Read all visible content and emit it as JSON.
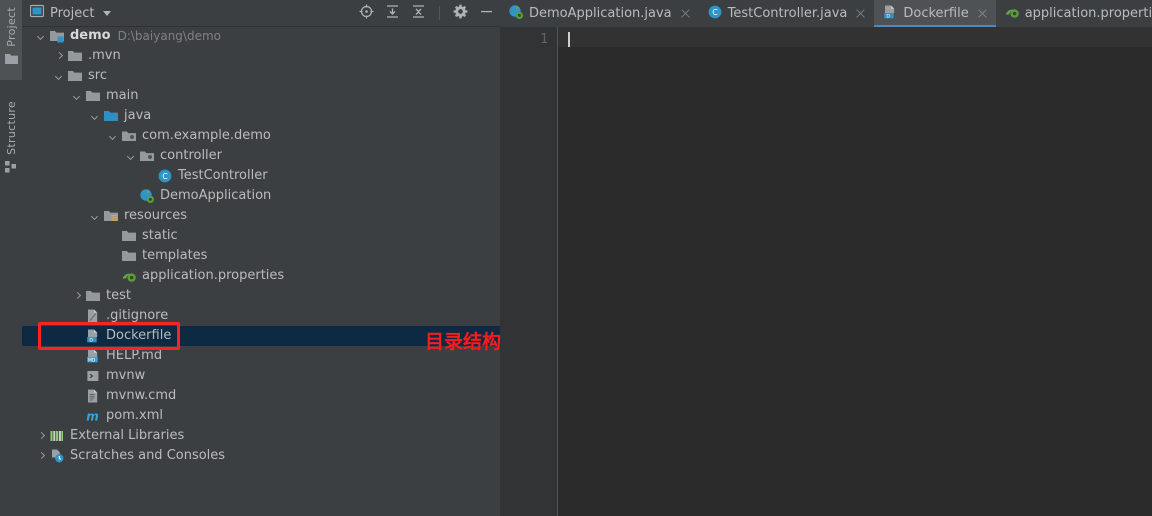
{
  "toolwindows": [
    {
      "label": "Project",
      "icon": "project-window-icon",
      "active": true
    },
    {
      "label": "Structure",
      "icon": "structure-window-icon",
      "active": false
    }
  ],
  "project_panel": {
    "title": "Project",
    "title_icon": "project-view-icon",
    "dropdown_icon": "chevron-down-icon",
    "tools": [
      {
        "name": "locate-in-tree-icon",
        "label": "Select Opened File"
      },
      {
        "name": "expand-all-icon",
        "label": "Expand All"
      },
      {
        "name": "collapse-all-icon",
        "label": "Collapse All"
      },
      {
        "name": "gear-icon",
        "label": "Show Options Menu"
      },
      {
        "name": "minimize-icon",
        "label": "Hide"
      }
    ],
    "tree": [
      {
        "label": "demo",
        "path": "D:\\baiyang\\demo",
        "icon": "module-folder-icon",
        "indent": 0,
        "arrow": "down",
        "bold": true,
        "selected": false
      },
      {
        "label": ".mvn",
        "path": "",
        "icon": "folder-icon",
        "indent": 1,
        "arrow": "right",
        "bold": false,
        "selected": false
      },
      {
        "label": "src",
        "path": "",
        "icon": "folder-icon",
        "indent": 1,
        "arrow": "down",
        "bold": false,
        "selected": false
      },
      {
        "label": "main",
        "path": "",
        "icon": "folder-icon",
        "indent": 2,
        "arrow": "down",
        "bold": false,
        "selected": false
      },
      {
        "label": "java",
        "path": "",
        "icon": "source-root-folder-icon",
        "indent": 3,
        "arrow": "down",
        "bold": false,
        "selected": false
      },
      {
        "label": "com.example.demo",
        "path": "",
        "icon": "package-icon",
        "indent": 4,
        "arrow": "down",
        "bold": false,
        "selected": false
      },
      {
        "label": "controller",
        "path": "",
        "icon": "package-icon",
        "indent": 5,
        "arrow": "down",
        "bold": false,
        "selected": false
      },
      {
        "label": "TestController",
        "path": "",
        "icon": "java-class-icon",
        "indent": 6,
        "arrow": "none",
        "bold": false,
        "selected": false
      },
      {
        "label": "DemoApplication",
        "path": "",
        "icon": "spring-boot-class-icon",
        "indent": 5,
        "arrow": "none",
        "bold": false,
        "selected": false
      },
      {
        "label": "resources",
        "path": "",
        "icon": "resource-root-folder-icon",
        "indent": 3,
        "arrow": "down",
        "bold": false,
        "selected": false
      },
      {
        "label": "static",
        "path": "",
        "icon": "folder-icon",
        "indent": 4,
        "arrow": "none",
        "bold": false,
        "selected": false
      },
      {
        "label": "templates",
        "path": "",
        "icon": "folder-icon",
        "indent": 4,
        "arrow": "none",
        "bold": false,
        "selected": false
      },
      {
        "label": "application.properties",
        "path": "",
        "icon": "spring-properties-icon",
        "indent": 4,
        "arrow": "none",
        "bold": false,
        "selected": false
      },
      {
        "label": "test",
        "path": "",
        "icon": "folder-icon",
        "indent": 2,
        "arrow": "right",
        "bold": false,
        "selected": false
      },
      {
        "label": ".gitignore",
        "path": "",
        "icon": "gitignore-file-icon",
        "indent": 2,
        "arrow": "none",
        "bold": false,
        "selected": false
      },
      {
        "label": "Dockerfile",
        "path": "",
        "icon": "docker-file-icon",
        "indent": 2,
        "arrow": "none",
        "bold": false,
        "selected": true
      },
      {
        "label": "HELP.md",
        "path": "",
        "icon": "markdown-file-icon",
        "indent": 2,
        "arrow": "none",
        "bold": false,
        "selected": false
      },
      {
        "label": "mvnw",
        "path": "",
        "icon": "shell-script-icon",
        "indent": 2,
        "arrow": "none",
        "bold": false,
        "selected": false
      },
      {
        "label": "mvnw.cmd",
        "path": "",
        "icon": "cmd-file-icon",
        "indent": 2,
        "arrow": "none",
        "bold": false,
        "selected": false
      },
      {
        "label": "pom.xml",
        "path": "",
        "icon": "maven-pom-icon",
        "indent": 2,
        "arrow": "none",
        "bold": false,
        "selected": false
      },
      {
        "label": "External Libraries",
        "path": "",
        "icon": "external-libraries-icon",
        "indent": 0,
        "arrow": "right",
        "bold": false,
        "selected": false
      },
      {
        "label": "Scratches and Consoles",
        "path": "",
        "icon": "scratches-icon",
        "indent": 0,
        "arrow": "right",
        "bold": false,
        "selected": false
      }
    ]
  },
  "editor": {
    "tabs": [
      {
        "label": "DemoApplication.java",
        "icon": "spring-boot-class-icon",
        "active": false,
        "closable": true
      },
      {
        "label": "TestController.java",
        "icon": "java-class-icon",
        "active": false,
        "closable": true
      },
      {
        "label": "Dockerfile",
        "icon": "docker-file-icon",
        "active": true,
        "closable": true
      },
      {
        "label": "application.properties",
        "icon": "spring-properties-icon",
        "active": false,
        "closable": true
      }
    ],
    "line_numbers": [
      "1"
    ],
    "content": ""
  },
  "annotations": {
    "callout_text": "目录结构",
    "highlight_color": "#fb2222",
    "selection_color": "#0d2a42",
    "accent_color": "#4a88c7"
  }
}
